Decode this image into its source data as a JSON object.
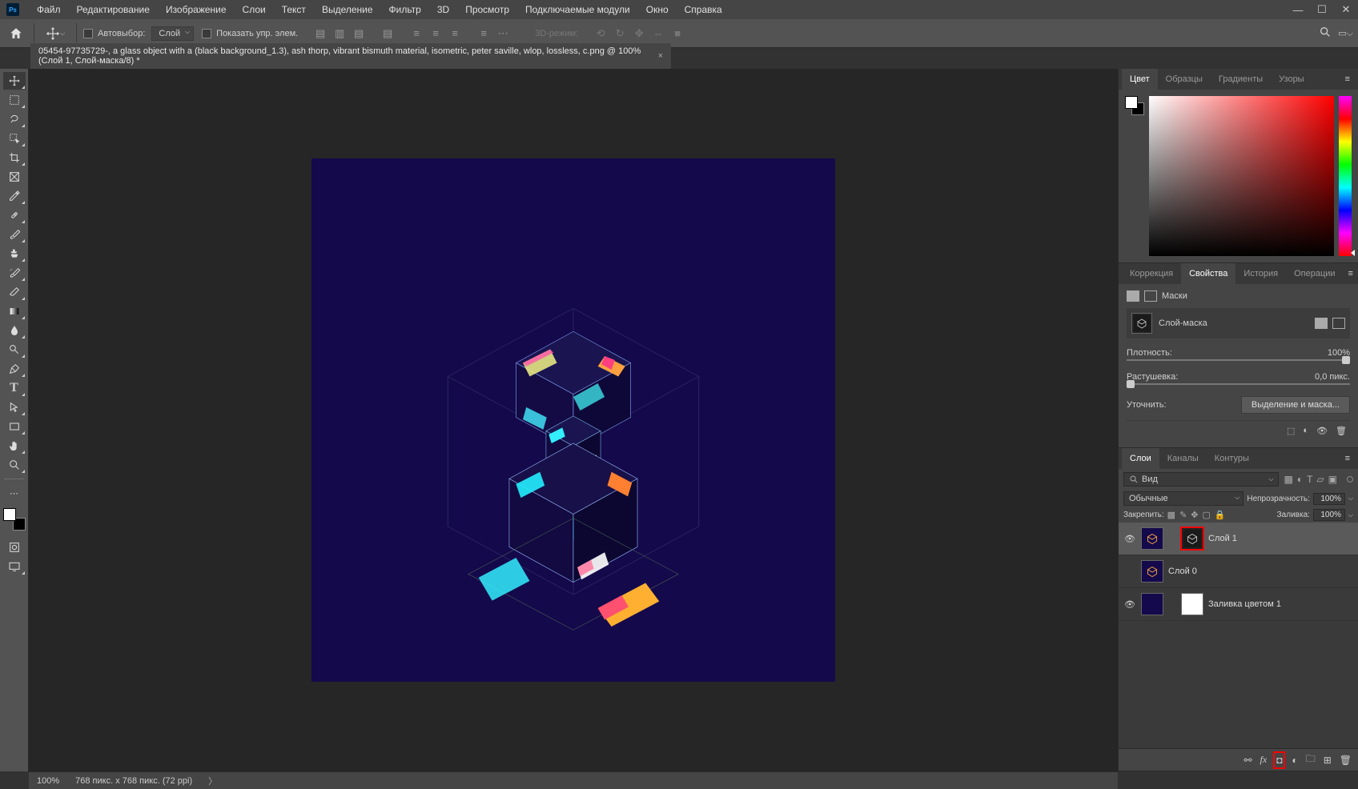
{
  "menu": {
    "items": [
      "Файл",
      "Редактирование",
      "Изображение",
      "Слои",
      "Текст",
      "Выделение",
      "Фильтр",
      "3D",
      "Просмотр",
      "Подключаемые модули",
      "Окно",
      "Справка"
    ]
  },
  "options": {
    "auto_select": "Автовыбор:",
    "layer_target": "Слой",
    "show_controls": "Показать упр. элем.",
    "mode3d": "3D-режим:"
  },
  "document": {
    "tab_title": "05454-97735729-, a glass object with a (black background_1.3), ash thorp, vibrant bismuth material, isometric, peter saville, wlop, lossless, c.png @ 100% (Слой 1, Слой-маска/8) *"
  },
  "panels": {
    "color": {
      "tabs": [
        "Цвет",
        "Образцы",
        "Градиенты",
        "Узоры"
      ],
      "active": 0
    },
    "props": {
      "tabs": [
        "Коррекция",
        "Свойства",
        "История",
        "Операции"
      ],
      "active": 1,
      "title": "Маски",
      "mask_label": "Слой-маска",
      "density_label": "Плотность:",
      "density_value": "100%",
      "feather_label": "Растушевка:",
      "feather_value": "0,0 пикс.",
      "refine_label": "Уточнить:",
      "refine_button": "Выделение и маска..."
    },
    "layers": {
      "tabs": [
        "Слои",
        "Каналы",
        "Контуры"
      ],
      "active": 0,
      "search_mode": "Вид",
      "blend_mode": "Обычные",
      "opacity_label": "Непрозрачность:",
      "opacity_value": "100%",
      "lock_label": "Закрепить:",
      "fill_label": "Заливка:",
      "fill_value": "100%",
      "items": [
        {
          "name": "Слой 1",
          "visible": true,
          "has_mask": true,
          "selected": true,
          "mask_highlighted": true
        },
        {
          "name": "Слой 0",
          "visible": false,
          "has_mask": false,
          "selected": false
        },
        {
          "name": "Заливка цветом 1",
          "visible": true,
          "has_mask": true,
          "selected": false,
          "fill_layer": true
        }
      ]
    }
  },
  "status": {
    "zoom": "100%",
    "doc_info": "768 пикс. x 768 пикс. (72 ppi)"
  },
  "tools": [
    "move",
    "artboard",
    "lasso",
    "quick-select",
    "crop",
    "frame",
    "eyedropper",
    "healing",
    "brush",
    "clone",
    "history-brush",
    "eraser",
    "gradient",
    "blur",
    "dodge",
    "pen",
    "type",
    "path-select",
    "rectangle",
    "hand",
    "zoom"
  ]
}
